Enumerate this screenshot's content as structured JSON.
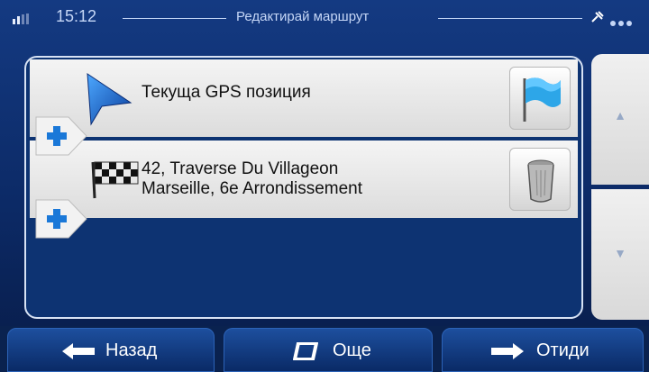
{
  "status": {
    "time": "15:12",
    "title": "Редактирай маршрут"
  },
  "route": {
    "items": [
      {
        "label": "Текуща GPS позиция",
        "icon": "position-arrow-icon",
        "action_icon": "flag-icon"
      },
      {
        "line1": "42, Traverse Du Villageon",
        "line2": "Marseille, 6e Arrondissement",
        "icon": "checkered-flag-icon",
        "action_icon": "trash-icon"
      }
    ]
  },
  "bottom": {
    "back": "Назад",
    "more": "Още",
    "go": "Отиди"
  },
  "colors": {
    "background": "#0d3372",
    "accent": "#1a78d8",
    "row": "#e6e6e6"
  }
}
